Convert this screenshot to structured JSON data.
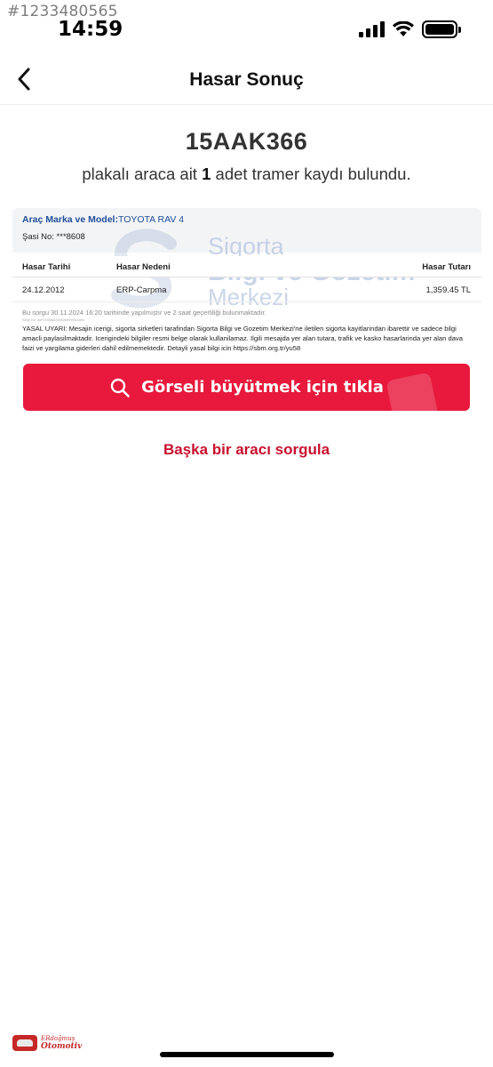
{
  "overlay": {
    "listing_id": "#1233480565"
  },
  "status_bar": {
    "time": "14:59",
    "icons": [
      "cellular-signal-icon",
      "wifi-icon",
      "battery-icon"
    ]
  },
  "nav": {
    "back_icon": "chevron-left-icon",
    "title": "Hasar Sonuç"
  },
  "result": {
    "plate": "15AAK366",
    "summary_prefix": "plakalı araca ait",
    "record_count": "1",
    "summary_suffix": "adet tramer kaydı bulundu."
  },
  "report": {
    "model_key": "Araç Marka ve Model:",
    "model_value": "TOYOTA RAV 4",
    "chassis_label": "Şasi No:",
    "chassis_value": "***8608",
    "watermark": {
      "line1": "Sigorta",
      "line2": "Bilgi ve Gözetim",
      "line3": "Merkezi"
    },
    "columns": [
      "Hasar Tarihi",
      "Hasar Nedeni",
      "Hasar Tutarı"
    ],
    "rows": [
      {
        "date": "24.12.2012",
        "reason": "ERP-Carpma",
        "amount": "1,359.45 TL"
      }
    ],
    "query_note": "Bu sorgu 30.11.2024 16:20 tarihinde yapılmıştır ve 2 saat geçerliliği bulunmaktadır.",
    "tiny_line": "Sorgu No: qwR7J98dgd23nfk2kdfrhr8h2c8ek",
    "legal_text": "YASAL UYARI: Mesajin icerigi, sigorta sirketleri tarafindan Sigorta Bilgi ve Gozetim Merkezi'ne iletilen sigorta kayitlarindan ibarettir ve sadece bilgi amacli paylasilmaktadir. Icerigindeki bilgiler resmi belge olarak kullanilamaz. Ilgili mesajda yer alan tutara, trafik ve kasko hasarlarinda yer alan dava faizi ve yargilama giderleri dahil edilmemektedir. Detayli yasal bilgi icin https://sbm.org.tr/yu58"
  },
  "actions": {
    "enlarge_label": "Görseli büyütmek için tıkla",
    "enlarge_icon": "search-icon",
    "another_query_label": "Başka bir aracı sorgula"
  },
  "brand_stamp": {
    "line1": "ERdoğmuş",
    "line2": "Otomotiv"
  },
  "colors": {
    "primary_red": "#e8193c",
    "link_red": "#c8102e",
    "model_blue": "#1e4e9a"
  }
}
